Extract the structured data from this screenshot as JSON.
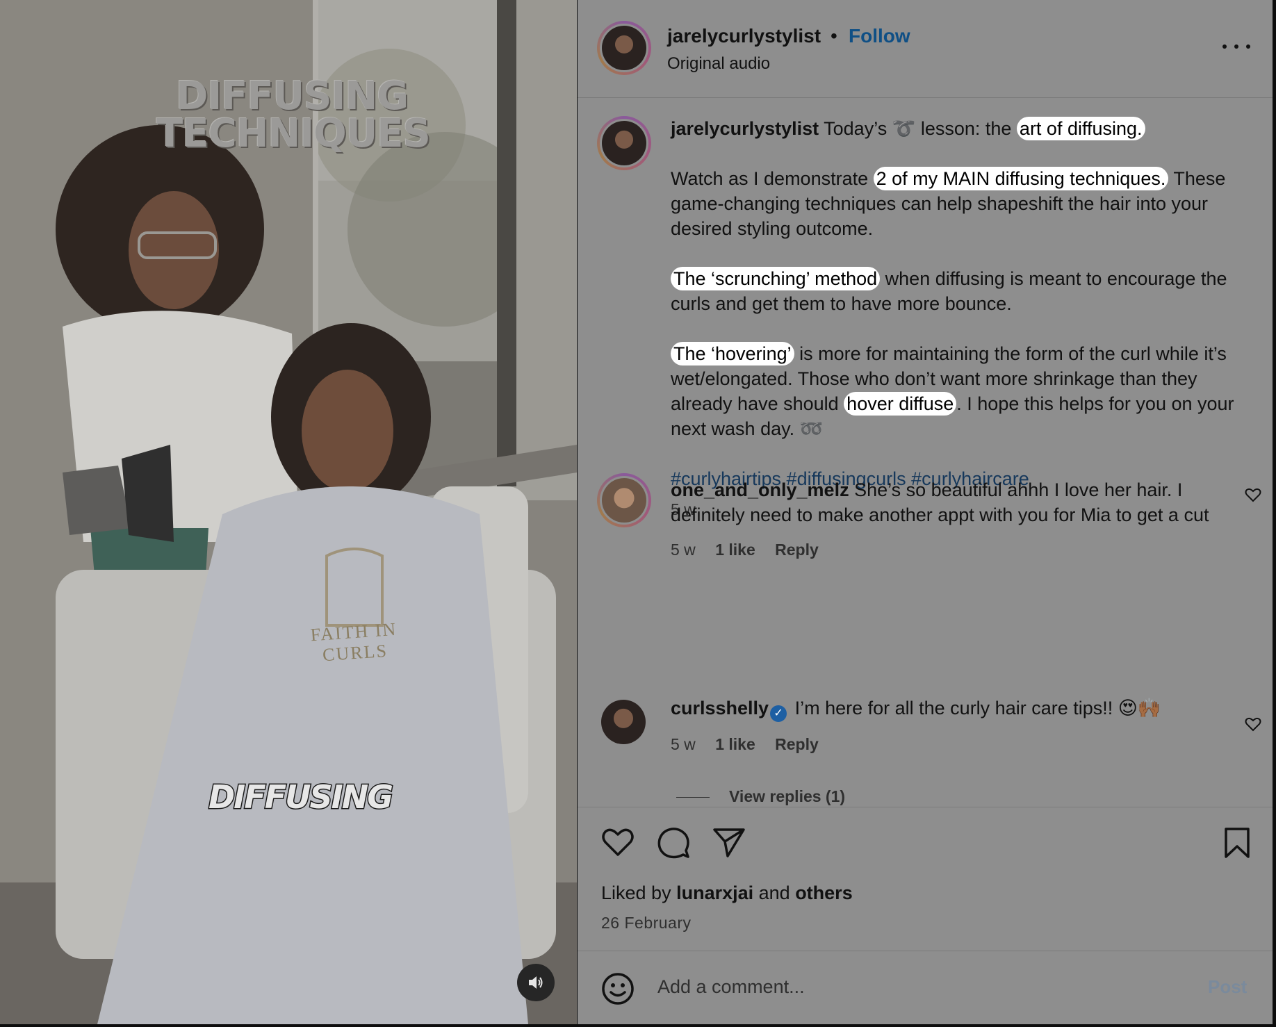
{
  "video": {
    "title_overlay_line1": "DIFFUSING",
    "title_overlay_line2": "TECHNIQUES",
    "caption_overlay": "DIFFUSING",
    "cape_brand": "FAITH IN CURLS",
    "sound_icon": "speaker-icon"
  },
  "header": {
    "username": "jarelycurlystylist",
    "separator": "•",
    "follow_label": "Follow",
    "audio_label": "Original audio",
    "more_icon": "more-options-icon"
  },
  "caption": {
    "username": "jarelycurlystylist",
    "p1_text": " Today’s ➰ lesson: the ",
    "p1_highlight": "art of diffusing.",
    "p2_text": "Watch as I demonstrate ",
    "p2_highlight": "2 of my MAIN diffusing techniques.",
    "p2_rest": " These game-changing techniques can help shapeshift the hair into your desired styling outcome.",
    "p3_highlight": "The ‘scrunching’ method",
    "p3_rest": " when diffusing is meant to encourage the curls and get them to have more bounce.",
    "p4_highlight": "The ‘hovering’",
    "p4_text": " is more for maintaining the form of the curl while it’s wet/elongated. Those who don’t want more shrinkage than they already have should ",
    "p4_highlight2": "hover diffuse",
    "p4_rest": ". I hope this helps for you on your next wash day. ",
    "p4_emoji": "➿",
    "hashtags": "#curlyhairtips #diffusingcurls #curlyhaircare",
    "time": "5 w"
  },
  "comments": [
    {
      "username": "one_and_only_melz",
      "text": " She’s so beautiful ahhh I love her hair. I definitely need to make another appt with you for Mia to get a cut",
      "time": "5 w",
      "likes": "1 like",
      "reply": "Reply"
    },
    {
      "username": "curlsshelly",
      "verified": "✓",
      "text": " I’m here for all the curly hair care tips!! 😍🙌🏾",
      "time": "5 w",
      "likes": "1 like",
      "reply": "Reply"
    }
  ],
  "view_replies": "View replies (1)",
  "actions": {
    "icons": [
      "heart-icon",
      "comment-icon",
      "share-icon",
      "bookmark-icon"
    ],
    "liked_prefix": "Liked by ",
    "liked_user": "lunarxjai",
    "liked_mid": " and ",
    "liked_others": "others",
    "date": "26 February"
  },
  "composer": {
    "placeholder": "Add a comment...",
    "post_label": "Post",
    "emoji_icon": "emoji-icon"
  },
  "colors": {
    "panel_bg": "#8e8e8e",
    "link_blue": "#0f4f85",
    "hashtag_blue": "#16385b",
    "highlight": "#ffffff"
  }
}
